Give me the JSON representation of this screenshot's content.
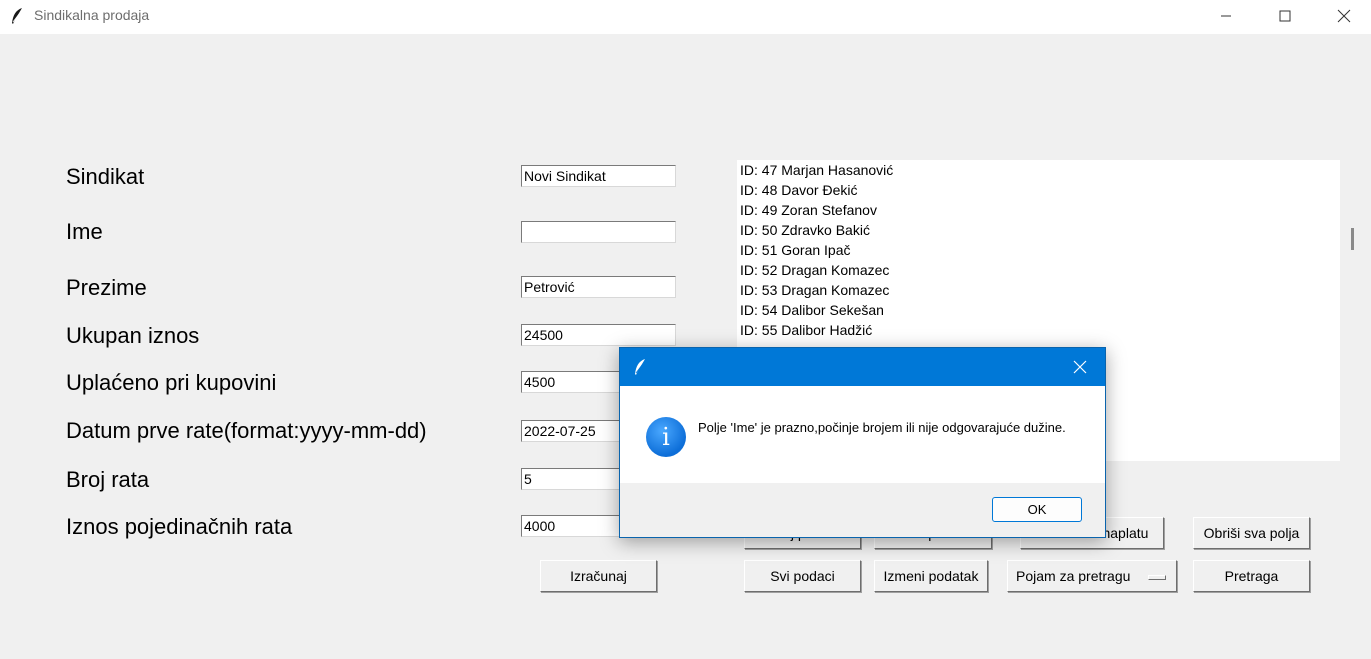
{
  "window": {
    "title": "Sindikalna prodaja",
    "icon": "feather-icon",
    "controls": [
      "minimize-icon",
      "maximize-icon",
      "close-icon"
    ]
  },
  "form": {
    "fields": [
      {
        "label": "Sindikat",
        "value": "Novi Sindikat"
      },
      {
        "label": "Ime",
        "value": ""
      },
      {
        "label": "Prezime",
        "value": "Petrović"
      },
      {
        "label": "Ukupan iznos",
        "value": "24500"
      },
      {
        "label": "Uplaćeno pri kupovini",
        "value": "4500"
      },
      {
        "label": "Datum prve rate(format:yyyy-mm-dd)",
        "value": "2022-07-25"
      },
      {
        "label": "Broj rata",
        "value": "5"
      },
      {
        "label": "Iznos pojedinačnih rata",
        "value": "4000"
      }
    ]
  },
  "list": {
    "items": [
      "ID: 47  Marjan  Hasanović",
      "ID: 48  Davor  Đekić",
      "ID: 49  Zoran  Stefanov",
      "ID: 50  Zdravko  Bakić",
      "ID: 51  Goran  Ipač",
      "ID: 52  Dragan  Komazec",
      "ID: 53  Dragan  Komazec",
      "ID: 54  Dalibor  Sekešan",
      "ID: 55  Dalibor  Hadžić"
    ]
  },
  "buttons": {
    "calculate": "Izračunaj",
    "add": "Dodaj podatak",
    "delete": "Obriši podatak",
    "due": "Uskoro za naplatu",
    "clear": "Obriši sva polja",
    "all": "Svi podaci",
    "edit": "Izmeni podatak",
    "search_term": "Pojam za pretragu",
    "search": "Pretraga"
  },
  "dialog": {
    "message": "Polje 'Ime' je prazno,počinje brojem ili nije odgovarajuće dužine.",
    "ok_label": "OK",
    "icon": "info-icon"
  },
  "colors": {
    "window_bg": "#f0f0f0",
    "dialog_title": "#0078d7",
    "accent": "#0078d7"
  }
}
